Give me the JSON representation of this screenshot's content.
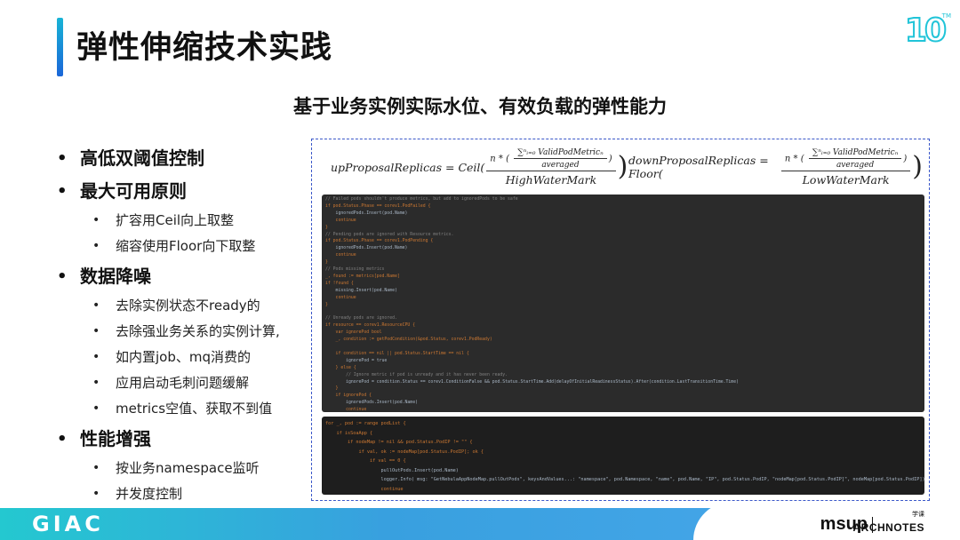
{
  "header": {
    "title": "弹性伸缩技术实践",
    "logo_text": "10",
    "logo_tm": "TM"
  },
  "subtitle": "基于业务实例实际水位、有效负载的弹性能力",
  "bullets": [
    {
      "text": "高低双阈值控制",
      "children": []
    },
    {
      "text": "最大可用原则",
      "children": [
        "扩容用Ceil向上取整",
        "缩容使用Floor向下取整"
      ]
    },
    {
      "text": "数据降噪",
      "children": [
        "去除实例状态不ready的",
        "去除强业务关系的实例计算,",
        "如内置job、mq消费的",
        "应用启动毛刺问题缓解",
        "metrics空值、获取不到值"
      ]
    },
    {
      "text": "性能增强",
      "children": [
        "按业务namespace监听",
        "并发度控制"
      ]
    }
  ],
  "formulas": {
    "up": {
      "lhs": "upProposalReplicas = Ceil(",
      "num_prefix": "n * (",
      "sum": "∑ⁿᵢ₌₀ ValidPodMetricₙ",
      "averaged": "averaged",
      "den": "HighWaterMark"
    },
    "down": {
      "lhs": "downProposalReplicas = Floor(",
      "num_prefix": "n * (",
      "sum": "∑ⁿᵢ₌₀ ValidPodMetricₙ",
      "averaged": "averaged",
      "den": "LowWaterMark"
    }
  },
  "code_a": [
    "// Failed pods shouldn't produce metrics, but add to ignoredPods to be safe",
    "if pod.Status.Phase == corev1.PodFailed {",
    "    ignoredPods.Insert(pod.Name)",
    "    continue",
    "}",
    "// Pending pods are ignored with Resource metrics.",
    "if pod.Status.Phase == corev1.PodPending {",
    "    ignoredPods.Insert(pod.Name)",
    "    continue",
    "}",
    "// Pods missing metrics",
    "_, found := metrics[pod.Name]",
    "if !found {",
    "    missing.Insert(pod.Name)",
    "    continue",
    "}",
    "",
    "// Unready pods are ignored.",
    "if resource == corev1.ResourceCPU {",
    "    var ignorePod bool",
    "    _, condition := getPodCondition(&pod.Status, corev1.PodReady)",
    "",
    "    if condition == nil || pod.Status.StartTime == nil {",
    "        ignorePod = true",
    "    } else {",
    "        // Ignore metric if pod is unready and it has never been ready.",
    "        ignorePod = condition.Status == corev1.ConditionFalse && pod.Status.StartTime.Add(delayOfInitialReadinessStatus).After(condition.LastTransitionTime.Time)",
    "    }",
    "    if ignorePod {",
    "        ignoredPods.Insert(pod.Name)",
    "        continue",
    "    }",
    "}"
  ],
  "code_b": [
    "for _, pod := range podList {",
    "    if isSoaApp {",
    "        if nodeMap != nil && pod.Status.PodIP != \"\" {",
    "            if val, ok := nodeMap[pod.Status.PodIP]; ok {",
    "                if val == 0 {",
    "                    pullOutPods.Insert(pod.Name)",
    "                    logger.Info( msg: \"GetNebulaAppNodeMap.pullOutPods\", keysAndValues...: \"namespace\", pod.Namespace, \"name\", pod.Name, \"IP\", pod.Status.PodIP, \"nodeMap[pod.Status.PodIP]\", nodeMap[pod.Status.PodIP])",
    "                    continue",
    "                }",
    "            }"
  ],
  "footer": {
    "left_logo": "GIAC",
    "msup": "msup",
    "archnotes": "ARCHNOTES",
    "archnotes_cn": "学课"
  },
  "colors": {
    "accent_start": "#18b4d6",
    "accent_end": "#1a66d8",
    "footer_start": "#24c8d0",
    "footer_end": "#4aa8ec",
    "figure_border": "#3a57c9"
  }
}
